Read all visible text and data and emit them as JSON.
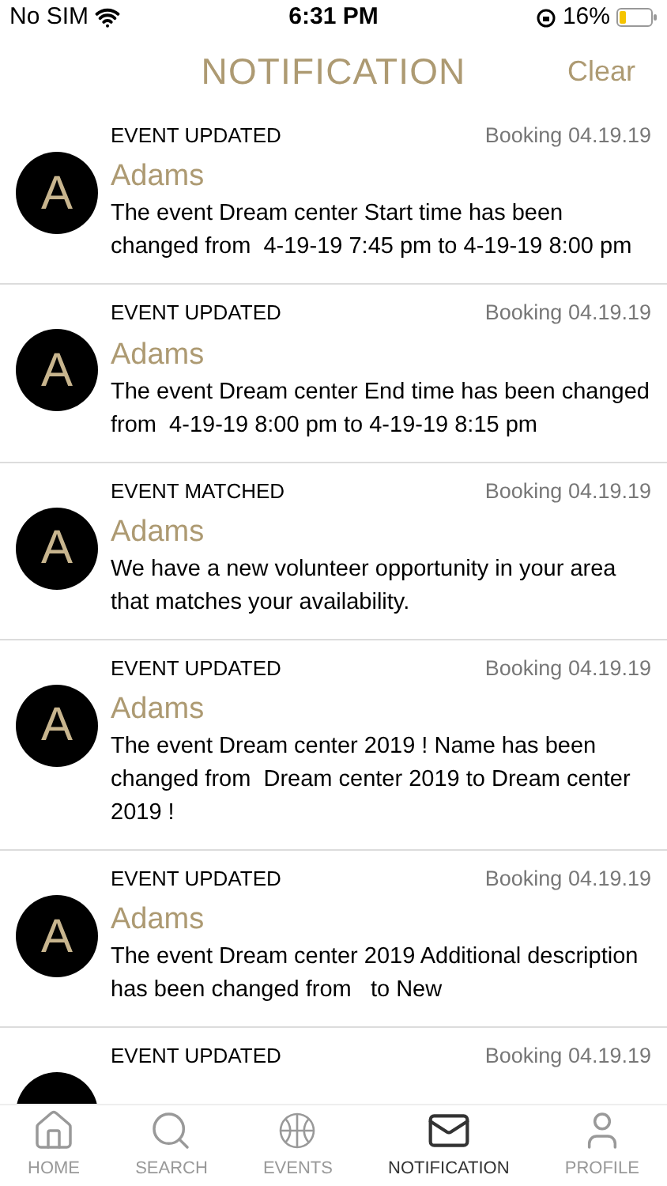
{
  "status_bar": {
    "carrier": "No SIM",
    "time": "6:31 PM",
    "battery": "16%"
  },
  "header": {
    "title": "NOTIFICATION",
    "action": "Clear"
  },
  "notifications": [
    {
      "type": "EVENT UPDATED",
      "meta": "Booking 04.19.19",
      "avatar": "A",
      "name": "Adams",
      "message": "The event Dream center Start time has been changed from  4-19-19 7:45 pm to 4-19-19 8:00 pm"
    },
    {
      "type": "EVENT UPDATED",
      "meta": "Booking 04.19.19",
      "avatar": "A",
      "name": "Adams",
      "message": "The event Dream center End time has been changed from  4-19-19 8:00 pm to 4-19-19 8:15 pm"
    },
    {
      "type": "EVENT MATCHED",
      "meta": "Booking 04.19.19",
      "avatar": "A",
      "name": "Adams",
      "message": "We have a new volunteer opportunity in your area that matches your availability."
    },
    {
      "type": "EVENT UPDATED",
      "meta": "Booking 04.19.19",
      "avatar": "A",
      "name": "Adams",
      "message": "The event Dream center 2019 ! Name has been changed from  Dream center 2019 to Dream center 2019 !"
    },
    {
      "type": "EVENT UPDATED",
      "meta": "Booking 04.19.19",
      "avatar": "A",
      "name": "Adams",
      "message": "The event Dream center 2019 Additional description has been changed from   to New"
    },
    {
      "type": "EVENT UPDATED",
      "meta": "Booking 04.19.19"
    }
  ],
  "tab_bar": [
    {
      "kind": "home",
      "label": "HOME",
      "selected": false
    },
    {
      "kind": "search",
      "label": "SEARCH",
      "selected": false
    },
    {
      "kind": "events",
      "label": "EVENTS",
      "selected": false
    },
    {
      "kind": "notification",
      "label": "NOTIFICATION",
      "selected": true
    },
    {
      "kind": "profile",
      "label": "PROFILE",
      "selected": false
    }
  ]
}
